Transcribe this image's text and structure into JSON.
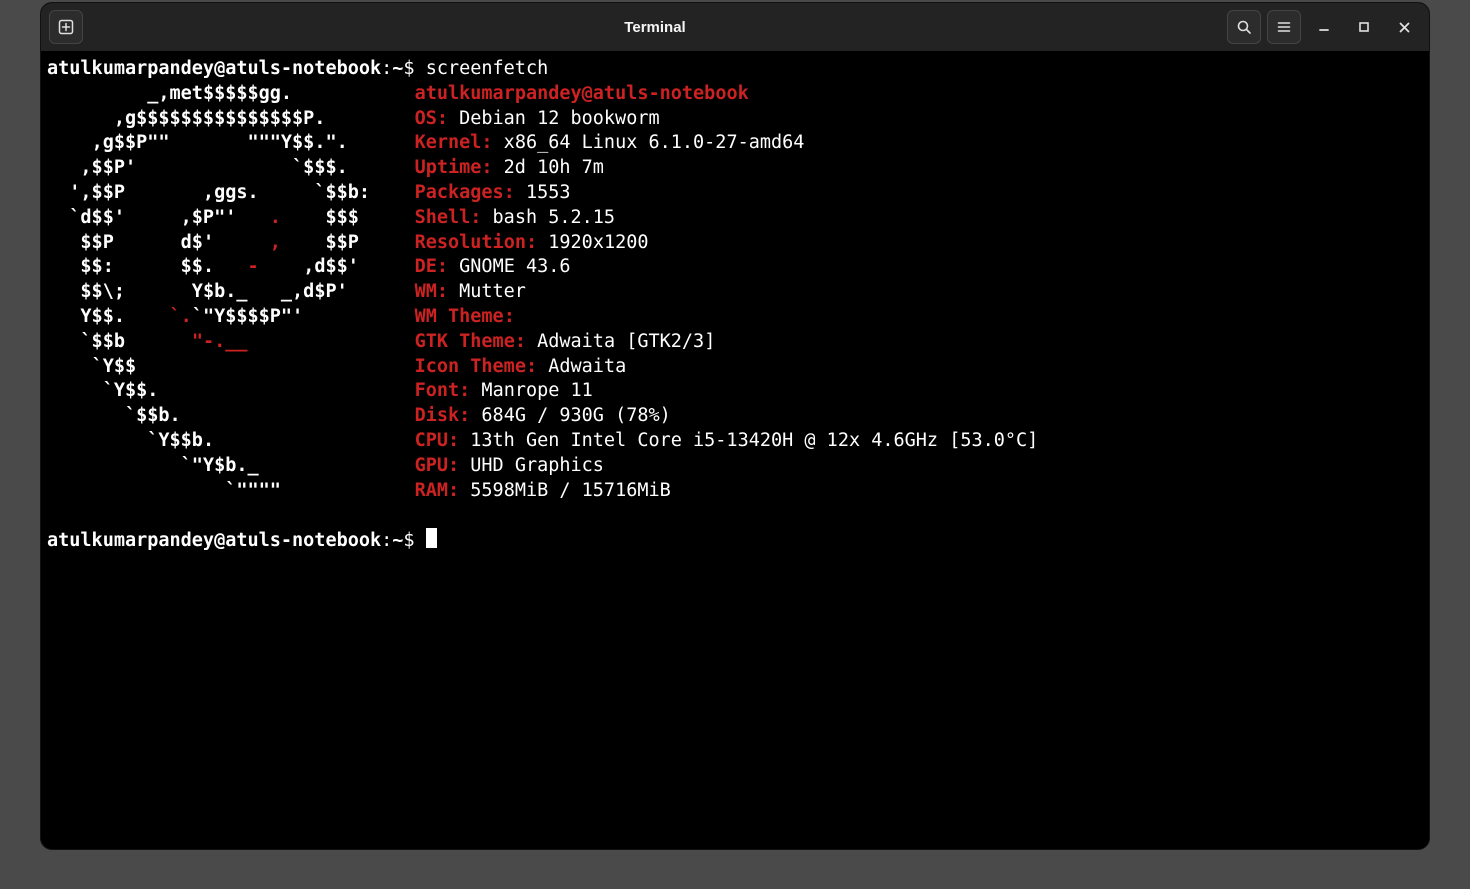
{
  "window": {
    "title": "Terminal"
  },
  "prompt": {
    "user": "atulkumarpandey",
    "host": "atuls-notebook",
    "path": "~",
    "command": "screenfetch"
  },
  "ascii_art": {
    "lines": [
      {
        "pre": "         ",
        "w": "_,met$$$$$gg."
      },
      {
        "pre": "      ",
        "w": ",g$$$$$$$$$$$$$$$P."
      },
      {
        "pre": "    ",
        "w": ",g$$P\"\"       \"\"\"Y$$.\"."
      },
      {
        "pre": "   ",
        "w": ",$$P'              `$$$."
      },
      {
        "pre": "  ",
        "w": "',$$P       ,ggs.     `$$b:"
      },
      {
        "pre": "  ",
        "w": "`d$$'     ,$P\"'   ",
        "r": ".",
        "w2": "    $$$"
      },
      {
        "pre": "   ",
        "w": "$$P      d$'     ",
        "r": ",",
        "w2": "    $$P"
      },
      {
        "pre": "   ",
        "w": "$$:      $$.   ",
        "r": "-",
        "w2": "    ,d$$'"
      },
      {
        "pre": "   ",
        "w": "$$\\;      Y$b._   _,d$P'"
      },
      {
        "pre": "   ",
        "w": "Y$$.    ",
        "r": "`.",
        "w2": "`\"Y$$$$P\"'"
      },
      {
        "pre": "   ",
        "w": "`$$b      ",
        "r": "\"-.__"
      },
      {
        "pre": "    ",
        "w": "`Y$$"
      },
      {
        "pre": "     ",
        "w": "`Y$$."
      },
      {
        "pre": "       ",
        "w": "`$$b."
      },
      {
        "pre": "         ",
        "w": "`Y$$b."
      },
      {
        "pre": "            ",
        "w": "`\"Y$b._"
      },
      {
        "pre": "                ",
        "w": "`\"\"\"\""
      }
    ]
  },
  "info": {
    "user": "atulkumarpandey",
    "at": "@",
    "host": "atuls-notebook",
    "rows": [
      {
        "label": "OS:",
        "value": " Debian 12 bookworm"
      },
      {
        "label": "Kernel:",
        "value": " x86_64 Linux 6.1.0-27-amd64"
      },
      {
        "label": "Uptime:",
        "value": " 2d 10h 7m"
      },
      {
        "label": "Packages:",
        "value": " 1553"
      },
      {
        "label": "Shell:",
        "value": " bash 5.2.15"
      },
      {
        "label": "Resolution:",
        "value": " 1920x1200"
      },
      {
        "label": "DE:",
        "value": " GNOME 43.6"
      },
      {
        "label": "WM:",
        "value": " Mutter"
      },
      {
        "label": "WM Theme:",
        "value": ""
      },
      {
        "label": "GTK Theme:",
        "value": " Adwaita [GTK2/3]"
      },
      {
        "label": "Icon Theme:",
        "value": " Adwaita"
      },
      {
        "label": "Font:",
        "value": " Manrope 11"
      },
      {
        "label": "Disk:",
        "value": " 684G / 930G (78%)"
      },
      {
        "label": "CPU:",
        "value": " 13th Gen Intel Core i5-13420H @ 12x 4.6GHz [53.0°C]"
      },
      {
        "label": "GPU:",
        "value": " UHD Graphics"
      },
      {
        "label": "RAM:",
        "value": " 5598MiB / 15716MiB"
      }
    ]
  }
}
